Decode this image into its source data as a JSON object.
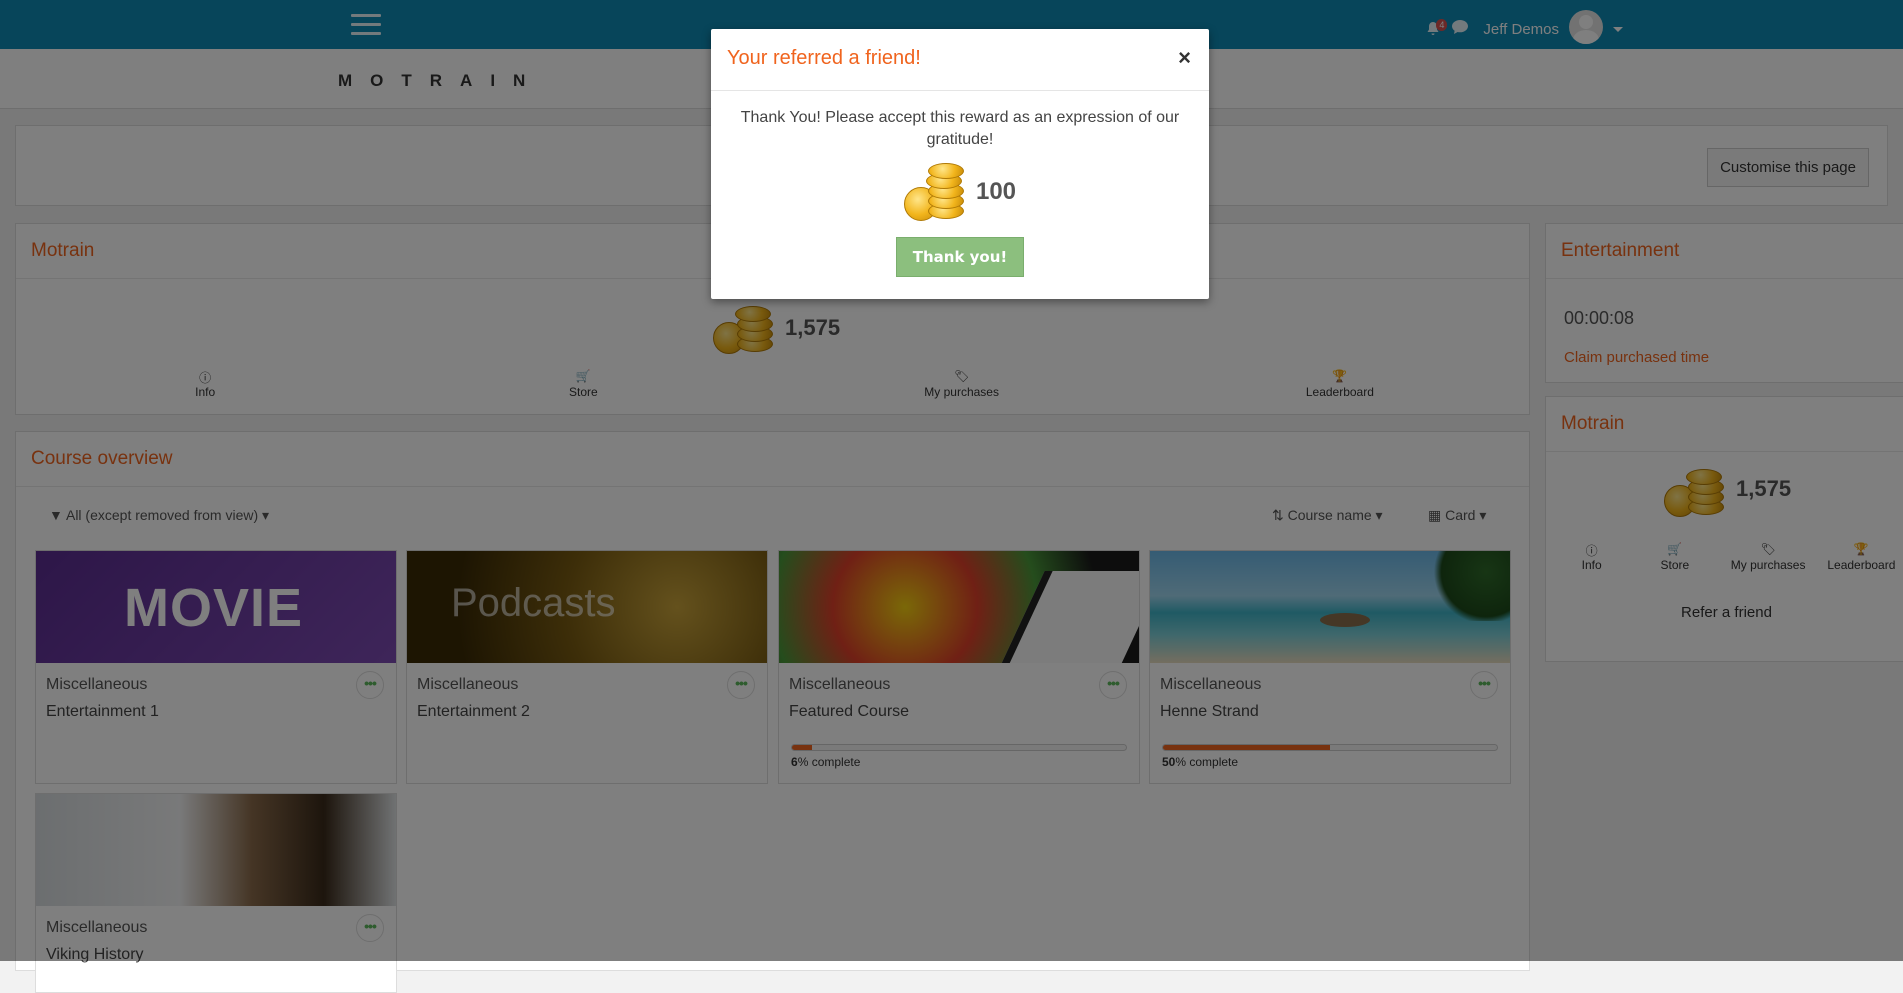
{
  "header": {
    "notification_count": "4",
    "user_name": "Jeff Demos"
  },
  "brand": {
    "logo_text": "MOTRAIN"
  },
  "page": {
    "customise_label": "Customise this page"
  },
  "motrain_main": {
    "title": "Motrain",
    "coins": "1,575",
    "nav": [
      {
        "label": "Info",
        "icon": "info-icon"
      },
      {
        "label": "Store",
        "icon": "cart-icon"
      },
      {
        "label": "My purchases",
        "icon": "tag-icon"
      },
      {
        "label": "Leaderboard",
        "icon": "trophy-icon"
      }
    ]
  },
  "course_overview": {
    "title": "Course overview",
    "filter_label": "All (except removed from view)",
    "sort_label": "Course name",
    "view_label": "Card",
    "courses": [
      {
        "category": "Miscellaneous",
        "name": "Entertainment 1",
        "image_text": "MOVIE"
      },
      {
        "category": "Miscellaneous",
        "name": "Entertainment 2",
        "image_text": "Podcasts"
      },
      {
        "category": "Miscellaneous",
        "name": "Featured Course",
        "progress": 6,
        "progress_suffix": "% complete"
      },
      {
        "category": "Miscellaneous",
        "name": "Henne Strand",
        "progress": 50,
        "progress_suffix": "% complete"
      },
      {
        "category": "Miscellaneous",
        "name": "Viking History"
      }
    ]
  },
  "entertainment_block": {
    "title": "Entertainment",
    "time": "00:00:08",
    "claim_label": "Claim purchased time"
  },
  "motrain_side": {
    "title": "Motrain",
    "coins": "1,575",
    "nav": [
      {
        "label": "Info",
        "icon": "info-icon"
      },
      {
        "label": "Store",
        "icon": "cart-icon"
      },
      {
        "label": "My purchases",
        "icon": "tag-icon"
      },
      {
        "label": "Leaderboard",
        "icon": "trophy-icon"
      }
    ],
    "refer_label": "Refer a friend"
  },
  "modal": {
    "title": "Your referred a friend!",
    "close": "×",
    "message": "Thank You! Please accept this reward as an expression of our gratitude!",
    "reward": "100",
    "button": "Thank you!"
  },
  "colors": {
    "topbar": "#0f8ab5",
    "accent": "#f0641e",
    "button_green": "#8cbf7e"
  }
}
